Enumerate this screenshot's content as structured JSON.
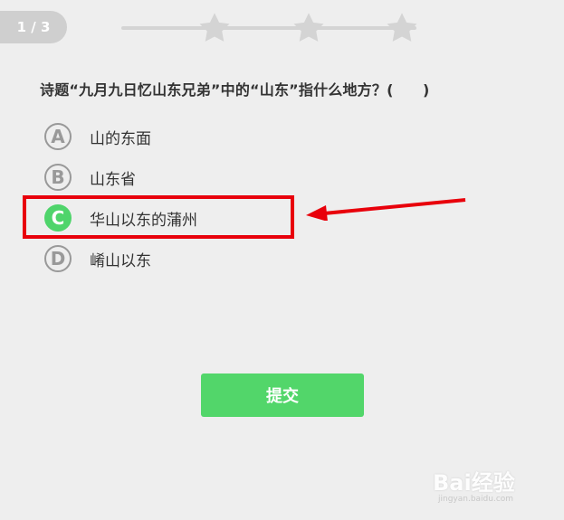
{
  "progress": {
    "counter": "1 / 3",
    "stars_total": 3,
    "stars_earned": 0
  },
  "question": {
    "text": "诗题“九月九日忆山东兄弟”中的“山东”指什么地方？(　　)"
  },
  "options": [
    {
      "letter": "A",
      "text": "山的东面",
      "selected": false
    },
    {
      "letter": "B",
      "text": "山东省",
      "selected": false
    },
    {
      "letter": "C",
      "text": "华山以东的蒲州",
      "selected": true
    },
    {
      "letter": "D",
      "text": "崤山以东",
      "selected": false
    }
  ],
  "submit": {
    "label": "提交"
  },
  "annotation": {
    "color": "#e8000b"
  },
  "colors": {
    "accent": "#4fd46b",
    "background": "#eeeeee"
  },
  "watermark": {
    "main": "Bai经验",
    "sub": "jingyan.baidu.com"
  }
}
